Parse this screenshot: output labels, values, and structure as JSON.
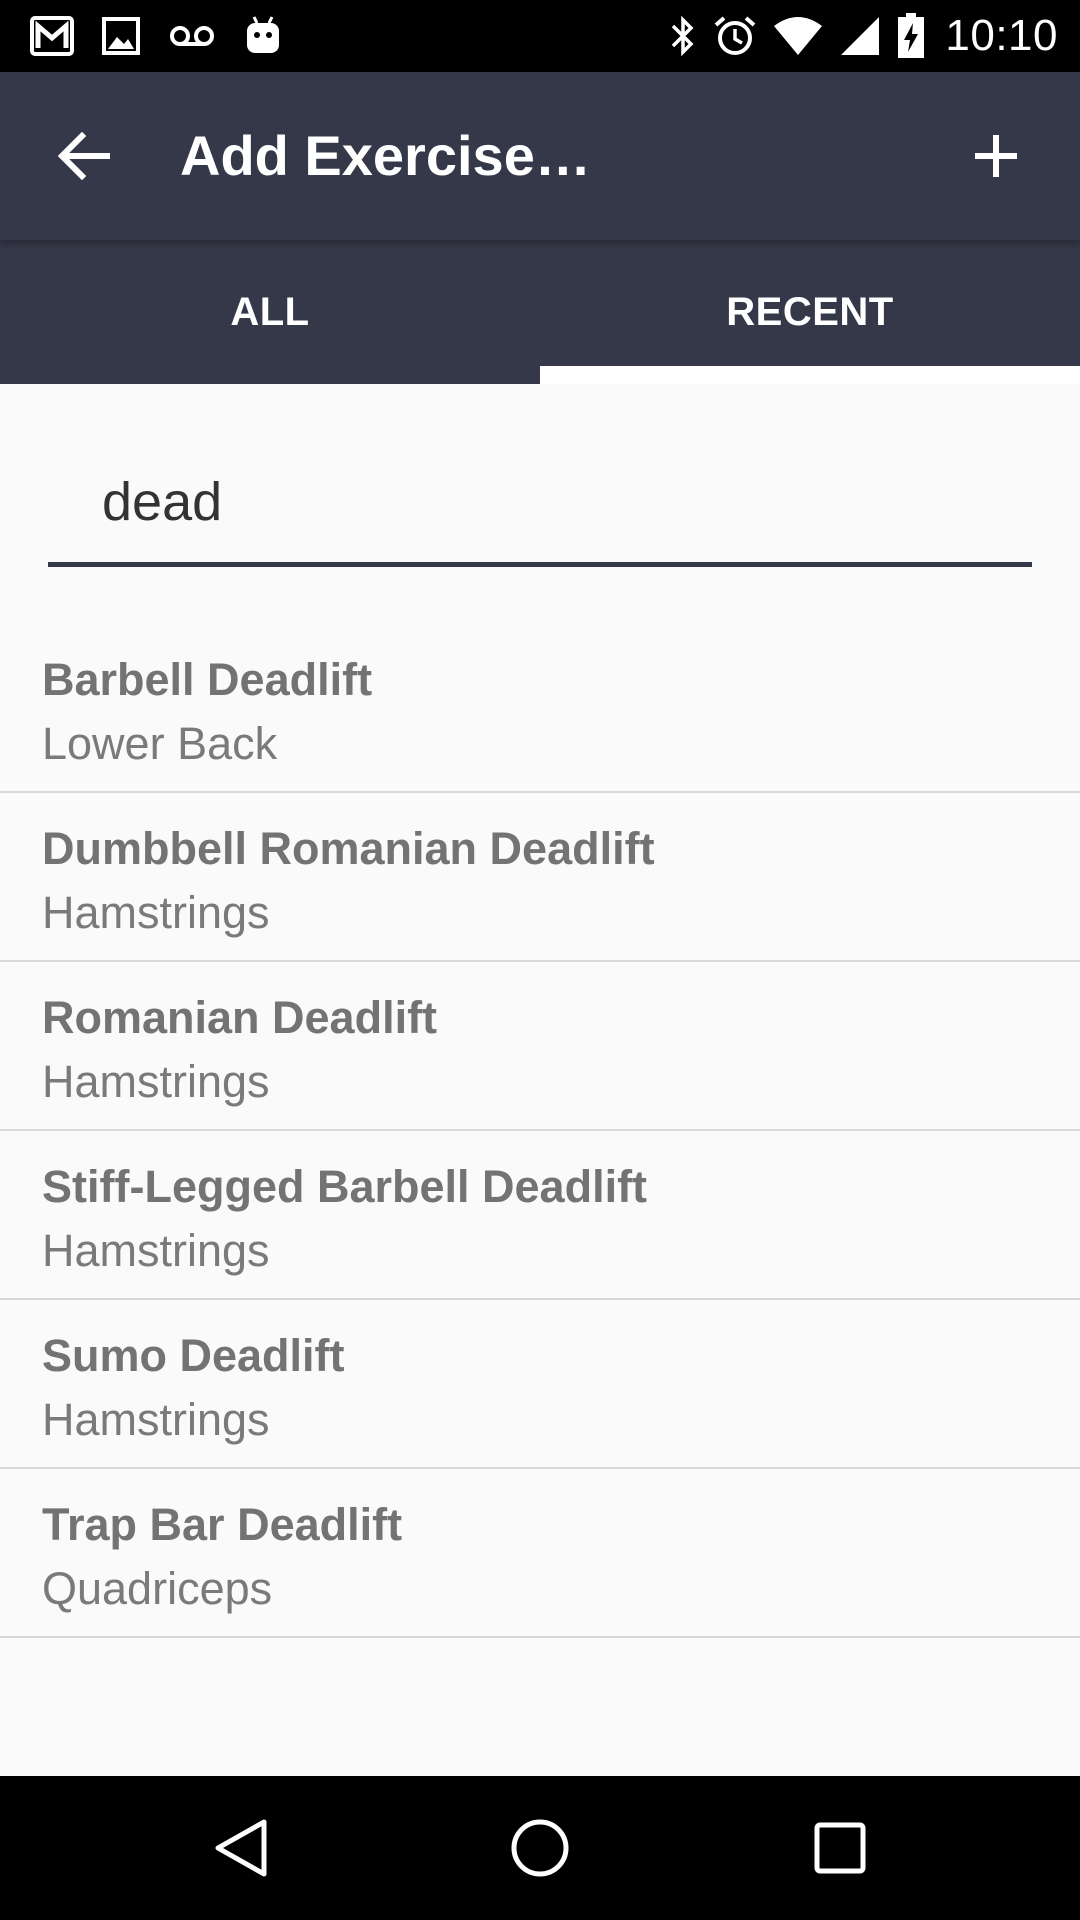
{
  "status_bar": {
    "time": "10:10",
    "left_icons": [
      "gmail-icon",
      "image-icon",
      "voicemail-icon",
      "android-icon"
    ],
    "right_icons": [
      "bluetooth-icon",
      "alarm-icon",
      "wifi-icon",
      "signal-icon",
      "battery-charging-icon"
    ]
  },
  "app_bar": {
    "title": "Add Exercise…",
    "back_icon": "arrow-back-icon",
    "add_icon": "plus-icon"
  },
  "tabs": [
    {
      "label": "ALL",
      "selected": false
    },
    {
      "label": "RECENT",
      "selected": true
    }
  ],
  "search": {
    "value": "dead"
  },
  "exercises": [
    {
      "name": "Barbell Deadlift",
      "muscle": "Lower Back"
    },
    {
      "name": "Dumbbell Romanian Deadlift",
      "muscle": "Hamstrings"
    },
    {
      "name": "Romanian Deadlift",
      "muscle": "Hamstrings"
    },
    {
      "name": "Stiff-Legged Barbell Deadlift",
      "muscle": "Hamstrings"
    },
    {
      "name": "Sumo Deadlift",
      "muscle": "Hamstrings"
    },
    {
      "name": "Trap Bar Deadlift",
      "muscle": "Quadriceps"
    }
  ],
  "nav_bar": {
    "icons": [
      "nav-back-icon",
      "nav-home-icon",
      "nav-recents-icon"
    ]
  },
  "colors": {
    "app_bar": "#353849",
    "background": "#fafafa",
    "item_text": "#737373",
    "divider": "#d9d9d9"
  }
}
